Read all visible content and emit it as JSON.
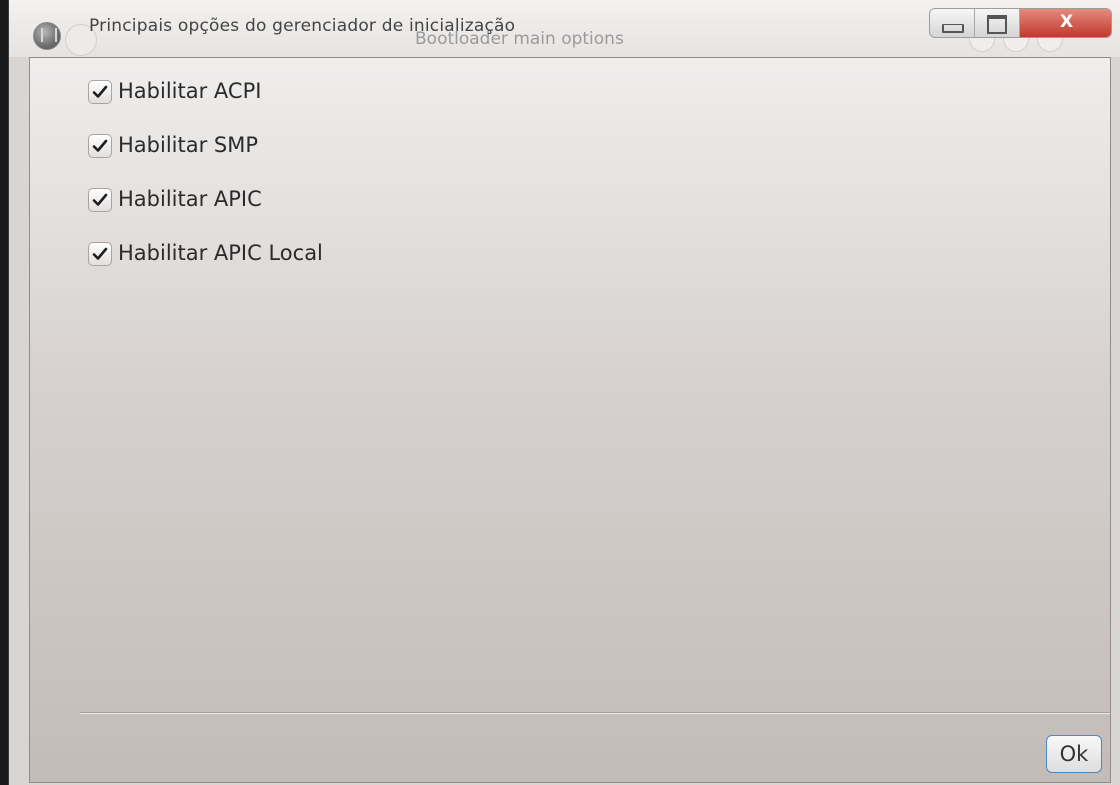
{
  "window": {
    "title": "Principais opções do gerenciador de inicialização",
    "ghost_title": "Bootloader main options",
    "close_label": "X"
  },
  "options": [
    {
      "label": "Habilitar ACPI",
      "checked": true
    },
    {
      "label": "Habilitar SMP",
      "checked": true
    },
    {
      "label": "Habilitar APIC",
      "checked": true
    },
    {
      "label": "Habilitar APIC Local",
      "checked": true
    }
  ],
  "buttons": {
    "ok_label": "Ok"
  },
  "colors": {
    "close_button": "#c0392b",
    "focus_border": "#4f86c6"
  }
}
